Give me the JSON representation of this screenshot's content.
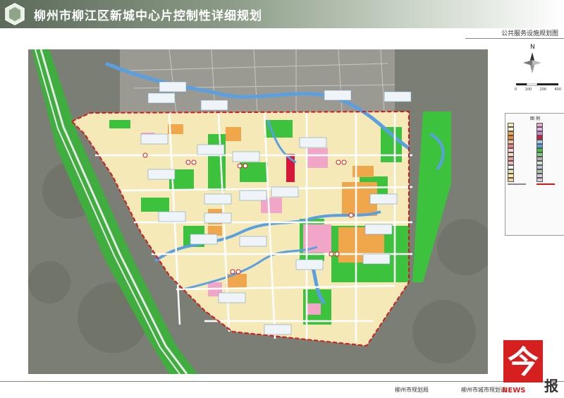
{
  "header": {
    "title": "柳州市柳江区新城中心片控制性详细规划"
  },
  "subheader": {
    "label": "公共服务设施规划图"
  },
  "compass": {
    "north_label": "N"
  },
  "scale": {
    "labels": [
      "0",
      "100",
      "200",
      "400"
    ]
  },
  "legend": {
    "title": "图 例"
  },
  "footer": {
    "bureau": "柳州市规划局",
    "institute": "柳州市城市规划设"
  },
  "watermark": {
    "main_text": "今",
    "side_text": "报",
    "news_text": "NEWS"
  },
  "colors": {
    "residential": "#f6e9b8",
    "commercial": "#f0a64a",
    "admin": "#f1a6c8",
    "green_space": "#3cc23c",
    "water": "#5aa0e0",
    "boundary": "#d31a1a",
    "terrain": "#7b7e74",
    "road": "#ffffff",
    "hospital": "#d4173a"
  }
}
